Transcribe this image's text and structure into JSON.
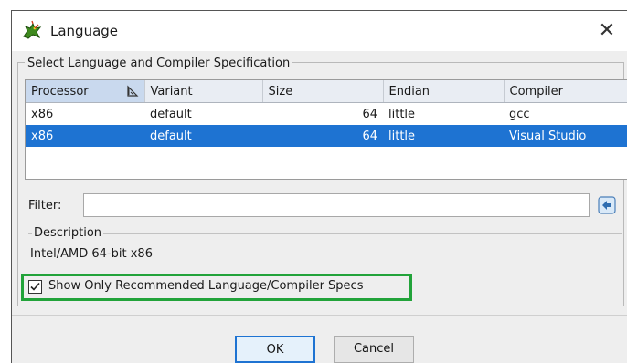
{
  "window": {
    "title": "Language",
    "close_glyph": "✕"
  },
  "group": {
    "title": "Select Language and Compiler Specification"
  },
  "table": {
    "headers": [
      "Processor",
      "Variant",
      "Size",
      "Endian",
      "Compiler"
    ],
    "rows": [
      [
        "x86",
        "default",
        "64",
        "little",
        "gcc"
      ],
      [
        "x86",
        "default",
        "64",
        "little",
        "Visual Studio"
      ]
    ],
    "selected_row": 1
  },
  "filter": {
    "label": "Filter:",
    "value": ""
  },
  "description": {
    "title": "Description",
    "text": "Intel/AMD 64-bit x86"
  },
  "recommended": {
    "label": "Show Only Recommended Language/Compiler Specs",
    "checked": true
  },
  "buttons": {
    "ok": "OK",
    "cancel": "Cancel"
  },
  "colors": {
    "selection": "#1e73d2",
    "highlight_box": "#22a33a",
    "header_bg": "#e9edf3"
  },
  "icons": {
    "title": "dragon-icon",
    "sort": "sort-icon",
    "filter_clear": "clear-filter-icon",
    "close": "close-icon"
  }
}
